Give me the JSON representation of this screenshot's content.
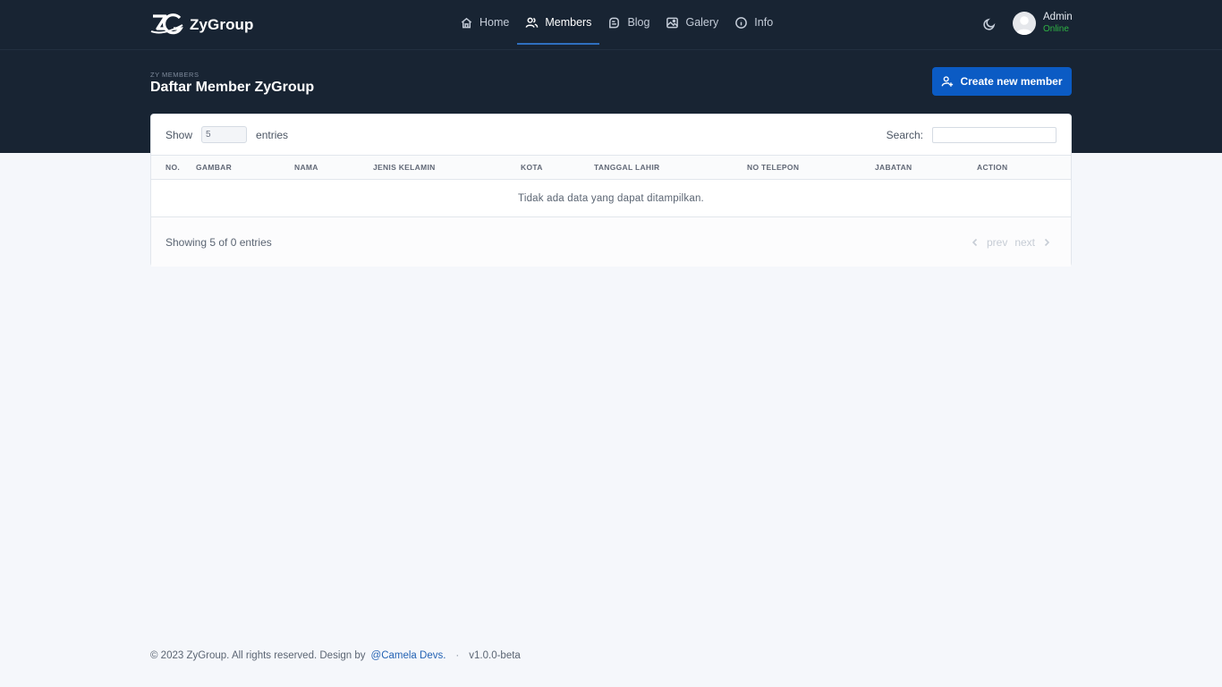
{
  "brand": {
    "name": "ZyGroup",
    "logo_icon": "zg-logo-icon"
  },
  "nav": [
    {
      "label": "Home",
      "icon": "home-icon",
      "active": false
    },
    {
      "label": "Members",
      "icon": "users-icon",
      "active": true
    },
    {
      "label": "Blog",
      "icon": "blog-icon",
      "active": false
    },
    {
      "label": "Galery",
      "icon": "image-icon",
      "active": false
    },
    {
      "label": "Info",
      "icon": "info-icon",
      "active": false
    }
  ],
  "user": {
    "name": "Admin",
    "status": "Online",
    "status_color": "#2fb344"
  },
  "page": {
    "pretitle": "ZY MEMBERS",
    "title": "Daftar Member ZyGroup",
    "create_button": "Create new member"
  },
  "table": {
    "length_label_before": "Show",
    "length_value": "5",
    "length_label_after": "entries",
    "search_label": "Search:",
    "search_value": "",
    "columns": [
      "NO.",
      "GAMBAR",
      "NAMA",
      "JENIS KELAMIN",
      "KOTA",
      "TANGGAL LAHIR",
      "NO TELEPON",
      "JABATAN",
      "ACTION"
    ],
    "empty_message": "Tidak ada data yang dapat ditampilkan.",
    "info": "Showing 5 of 0 entries",
    "prev_label": "prev",
    "next_label": "next"
  },
  "footer": {
    "copyright": "© 2023 ZyGroup. All rights reserved. Design by",
    "author_link": "@Camela Devs.",
    "separator": "·",
    "version": "v1.0.0-beta"
  },
  "colors": {
    "header_bg": "#182433",
    "accent": "#0b5bc4",
    "page_bg": "#f5f7fb"
  }
}
